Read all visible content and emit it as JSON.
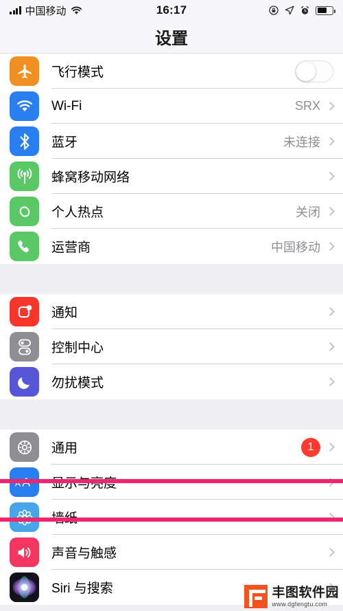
{
  "status_bar": {
    "carrier": "中国移动",
    "time": "16:17",
    "signal_icon": "cellular-signal-icon",
    "wifi_icon": "wifi-icon",
    "rotation_lock_icon": "rotation-lock-icon",
    "location_icon": "location-arrow-icon",
    "alarm_icon": "alarm-clock-icon",
    "battery_icon": "battery-icon",
    "battery_level_percent": 62
  },
  "navbar": {
    "title": "设置"
  },
  "groups": [
    {
      "id": "connectivity",
      "rows": [
        {
          "name": "airplane-mode",
          "label": "飞行模式",
          "icon": "airplane-icon",
          "icon_color": "#f09023",
          "control": "toggle",
          "toggle_on": false
        },
        {
          "name": "wifi",
          "label": "Wi-Fi",
          "icon": "wifi-icon",
          "icon_color": "#2a7ff0",
          "control": "value",
          "value": "SRX"
        },
        {
          "name": "bluetooth",
          "label": "蓝牙",
          "icon": "bluetooth-icon",
          "icon_color": "#2a7ff0",
          "control": "value",
          "value": "未连接"
        },
        {
          "name": "cellular",
          "label": "蜂窝移动网络",
          "icon": "cellular-tower-icon",
          "icon_color": "#5ac864",
          "control": "value",
          "value": ""
        },
        {
          "name": "personal-hotspot",
          "label": "个人热点",
          "icon": "hotspot-link-icon",
          "icon_color": "#5ac864",
          "control": "value",
          "value": "关闭"
        },
        {
          "name": "carrier",
          "label": "运营商",
          "icon": "phone-handset-icon",
          "icon_color": "#5ac864",
          "control": "value",
          "value": "中国移动"
        }
      ]
    },
    {
      "id": "notifications",
      "rows": [
        {
          "name": "notifications",
          "label": "通知",
          "icon": "notification-badge-icon",
          "icon_color": "#f6352b",
          "control": "value",
          "value": ""
        },
        {
          "name": "control-center",
          "label": "控制中心",
          "icon": "control-center-toggles-icon",
          "icon_color": "#8e8e93",
          "control": "value",
          "value": ""
        },
        {
          "name": "do-not-disturb",
          "label": "勿扰模式",
          "icon": "crescent-moon-icon",
          "icon_color": "#5756d6",
          "control": "value",
          "value": ""
        }
      ]
    },
    {
      "id": "system",
      "rows": [
        {
          "name": "general",
          "label": "通用",
          "icon": "gear-icon",
          "icon_color": "#8e8e93",
          "control": "badge",
          "badge": "1"
        },
        {
          "name": "display-brightness",
          "label": "显示与亮度",
          "icon": "text-size-aa-icon",
          "icon_color": "#2a7ff0",
          "control": "value",
          "value": "",
          "highlighted": true
        },
        {
          "name": "wallpaper",
          "label": "墙纸",
          "icon": "flower-wallpaper-icon",
          "icon_color": "#47a6e8",
          "control": "value",
          "value": ""
        },
        {
          "name": "sounds-haptics",
          "label": "声音与触感",
          "icon": "speaker-volume-icon",
          "icon_color": "#f4355f",
          "control": "value",
          "value": ""
        },
        {
          "name": "siri-search",
          "label": "Siri 与搜索",
          "icon": "siri-orb-icon",
          "icon_color": "#1b1b2a",
          "control": "value",
          "value": ""
        }
      ]
    }
  ],
  "highlight": {
    "color": "#f0256f",
    "target_row": "显示与亮度"
  },
  "watermark": {
    "name": "丰图软件园",
    "url": "www.dgfengtu.com"
  }
}
